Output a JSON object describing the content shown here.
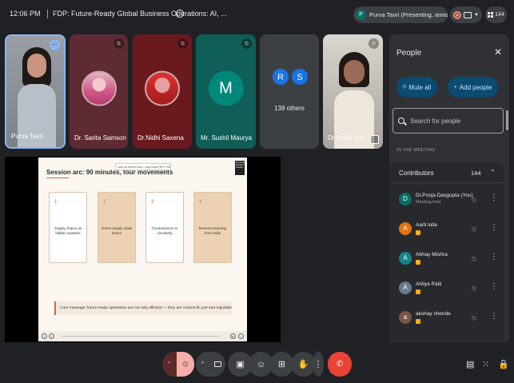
{
  "header": {
    "time": "12:06 PM",
    "meeting_title": "FDP: Future-Ready Global Business Operations: AI, ...",
    "info_icon": "i",
    "presenter_chip": {
      "avatar_letter": "P",
      "text": "Purva Tavri (Presenting, annotating)"
    },
    "participant_count": "144"
  },
  "tiles": [
    {
      "name": "Purva Tavri",
      "more_icon": "⋯"
    },
    {
      "name": "Dr. Sarita Samson",
      "mute_icon": "🎙"
    },
    {
      "name": "Dr.Nidhi Saxena",
      "mute_icon": "🎙"
    },
    {
      "name": "Mr. Sushil Maurya",
      "avatar_letter": "M",
      "mute_icon": "🎙"
    },
    {
      "others_label": "138 others",
      "avatar_letters": [
        "R",
        "S"
      ]
    },
    {
      "name": "Dr.Pooja Das..."
    }
  ],
  "slide": {
    "title": "Session arc: 90 minutes, four movements",
    "join_text": "Join at menti.com | use code 3977 6871",
    "logo_text": "Knowledge Business Leaders",
    "cards": [
      {
        "num": "1",
        "text": "Supply chains as hidden systems"
      },
      {
        "num": "2",
        "text": "Green supply chain levers"
      },
      {
        "num": "3",
        "text": "Consumerism to circularity"
      },
      {
        "num": "4",
        "text": "Reverse learning from India"
      }
    ],
    "core_message": "Core message: future-ready operations are not only efficient — they are context-fit, just and regulable."
  },
  "people_panel": {
    "title": "People",
    "close_icon": "✕",
    "mute_all_label": "Mute all",
    "add_people_label": "Add people",
    "search_placeholder": "Search for people",
    "section_label": "IN THE MEETING",
    "contributors_label": "Contributors",
    "contributors_count": "144",
    "participants": [
      {
        "initial": "D",
        "name": "Dr.Pooja Dasgupta (You)",
        "sub": "Meeting host",
        "color": "#0b6e64"
      },
      {
        "initial": "A",
        "name": "Aarti lulla",
        "sub": "",
        "color": "#e8710a"
      },
      {
        "initial": "A",
        "name": "Abhay Mishra",
        "sub": "",
        "color": "#12858b"
      },
      {
        "initial": "A",
        "name": "Ahilya Patil",
        "sub": "",
        "color": "#6a7a8c"
      },
      {
        "initial": "a",
        "name": "akshay shende",
        "sub": "",
        "color": "#795548"
      }
    ]
  },
  "toolbar": {
    "mic_caret": "^",
    "cam_caret": "^",
    "icons": [
      "caption-icon",
      "emoji-icon",
      "present-icon",
      "raise-hand-icon",
      "more-icon",
      "end-call-icon",
      "chat-icon",
      "activities-icon",
      "lock-icon"
    ]
  },
  "colors": {
    "background": "#202124",
    "panel": "#303134",
    "accent_blue": "#8ab4f8",
    "end_call": "#ea4335",
    "mic_off": "#f6aea9"
  }
}
